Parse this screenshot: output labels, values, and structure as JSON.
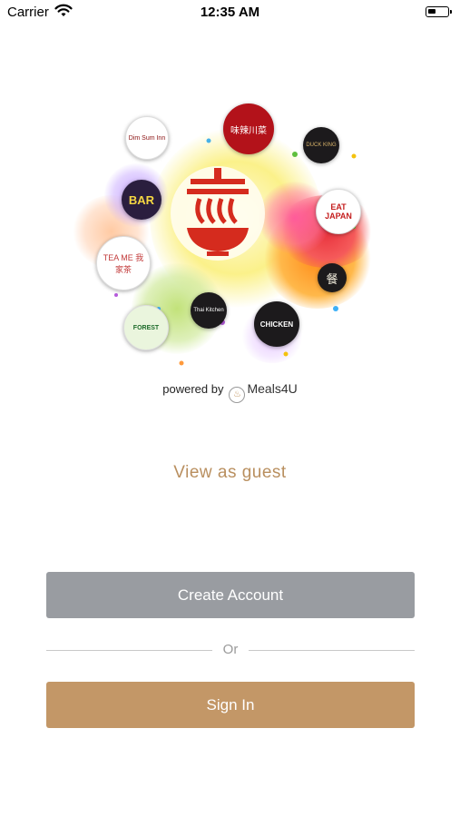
{
  "status_bar": {
    "carrier": "Carrier",
    "time": "12:35 AM"
  },
  "hero": {
    "restaurant_logos": [
      {
        "id": "dim-sum",
        "text": "Dim Sum Inn"
      },
      {
        "id": "sichuan",
        "text": "味辣川菜"
      },
      {
        "id": "duck-king",
        "text": "DUCK KING"
      },
      {
        "id": "bar",
        "text": "BAR"
      },
      {
        "id": "eat-japan",
        "text": "EAT JAPAN"
      },
      {
        "id": "tea-me",
        "text": "TEA ME 我家茶"
      },
      {
        "id": "chinese-square",
        "text": "餐"
      },
      {
        "id": "thai-kitchen",
        "text": "Thai Kitchen"
      },
      {
        "id": "forest",
        "text": "FOREST"
      },
      {
        "id": "chicken",
        "text": "CHICKEN"
      }
    ]
  },
  "powered_by": {
    "label": "powered by",
    "brand": "Meals4U"
  },
  "guest_link": "View as guest",
  "create_account": "Create Account",
  "or_separator": "Or",
  "sign_in": "Sign In",
  "colors": {
    "accent": "#c39767",
    "secondary_button": "#999ca1",
    "guest_text": "#b98f5f"
  }
}
